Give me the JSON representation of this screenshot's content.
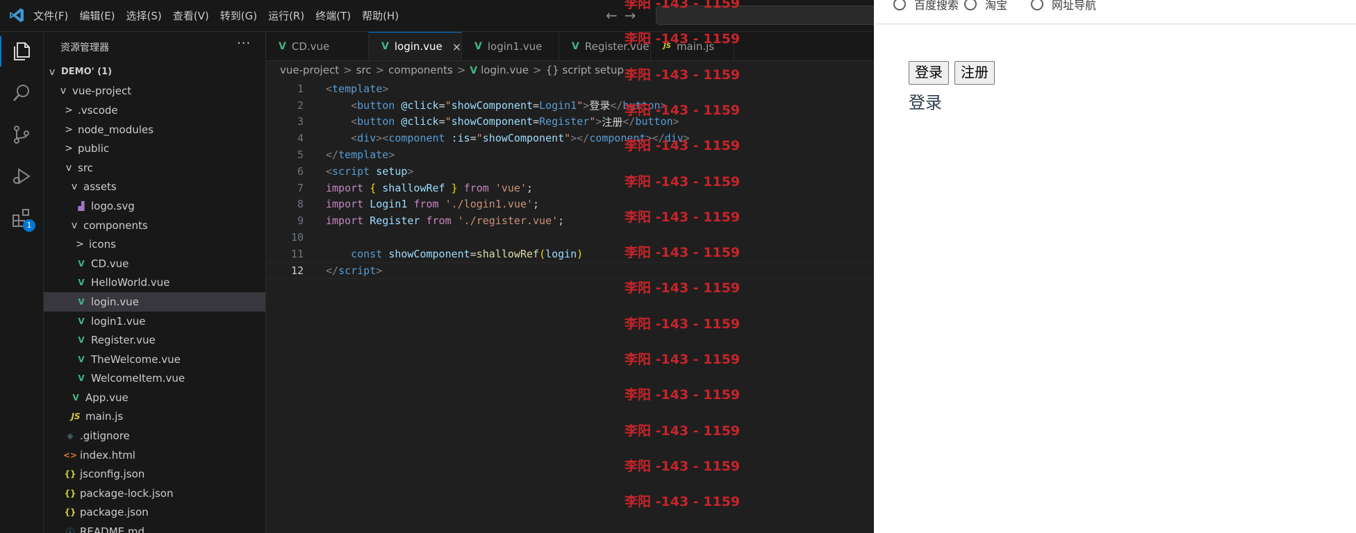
{
  "menu": [
    "文件(F)",
    "编辑(E)",
    "选择(S)",
    "查看(V)",
    "转到(G)",
    "运行(R)",
    "终端(T)",
    "帮助(H)"
  ],
  "nav": {
    "back": "←",
    "forward": "→"
  },
  "activity": {
    "extensions_badge": "1"
  },
  "sidebar": {
    "title": "资源管理器",
    "more": "···",
    "tree": [
      {
        "label": "DEMO' (1)",
        "depth": 0,
        "chevron": "open",
        "icon": "",
        "bold": true
      },
      {
        "label": "vue-project",
        "depth": 1,
        "chevron": "open",
        "icon": ""
      },
      {
        "label": ".vscode",
        "depth": 2,
        "chevron": "closed",
        "icon": ""
      },
      {
        "label": "node_modules",
        "depth": 2,
        "chevron": "closed",
        "icon": ""
      },
      {
        "label": "public",
        "depth": 2,
        "chevron": "closed",
        "icon": ""
      },
      {
        "label": "src",
        "depth": 2,
        "chevron": "open",
        "icon": ""
      },
      {
        "label": "assets",
        "depth": 3,
        "chevron": "open",
        "icon": ""
      },
      {
        "label": "logo.svg",
        "depth": 4,
        "chevron": "",
        "icon": "svg"
      },
      {
        "label": "components",
        "depth": 3,
        "chevron": "open",
        "icon": ""
      },
      {
        "label": "icons",
        "depth": 4,
        "chevron": "closed",
        "icon": ""
      },
      {
        "label": "CD.vue",
        "depth": 4,
        "chevron": "",
        "icon": "vue"
      },
      {
        "label": "HelloWorld.vue",
        "depth": 4,
        "chevron": "",
        "icon": "vue"
      },
      {
        "label": "login.vue",
        "depth": 4,
        "chevron": "",
        "icon": "vue",
        "selected": true
      },
      {
        "label": "login1.vue",
        "depth": 4,
        "chevron": "",
        "icon": "vue"
      },
      {
        "label": "Register.vue",
        "depth": 4,
        "chevron": "",
        "icon": "vue"
      },
      {
        "label": "TheWelcome.vue",
        "depth": 4,
        "chevron": "",
        "icon": "vue"
      },
      {
        "label": "WelcomeItem.vue",
        "depth": 4,
        "chevron": "",
        "icon": "vue"
      },
      {
        "label": "App.vue",
        "depth": 3,
        "chevron": "",
        "icon": "vue"
      },
      {
        "label": "main.js",
        "depth": 3,
        "chevron": "",
        "icon": "js"
      },
      {
        "label": ".gitignore",
        "depth": 2,
        "chevron": "",
        "icon": "git"
      },
      {
        "label": "index.html",
        "depth": 2,
        "chevron": "",
        "icon": "html"
      },
      {
        "label": "jsconfig.json",
        "depth": 2,
        "chevron": "",
        "icon": "json"
      },
      {
        "label": "package-lock.json",
        "depth": 2,
        "chevron": "",
        "icon": "json"
      },
      {
        "label": "package.json",
        "depth": 2,
        "chevron": "",
        "icon": "json"
      },
      {
        "label": "README.md",
        "depth": 2,
        "chevron": "",
        "icon": "info"
      }
    ]
  },
  "icons": {
    "vue": "V",
    "js": "JS",
    "json": "{}",
    "html": "<>",
    "git": "◆",
    "svg": "▟",
    "info": "ⓘ",
    "chevron_open": "v",
    "chevron_closed": ">"
  },
  "tabs": [
    {
      "label": "CD.vue",
      "icon": "vue",
      "active": false
    },
    {
      "label": "login.vue",
      "icon": "vue",
      "active": true
    },
    {
      "label": "login1.vue",
      "icon": "vue",
      "active": false
    },
    {
      "label": "Register.vue",
      "icon": "vue",
      "active": false
    },
    {
      "label": "main.js",
      "icon": "js",
      "active": false
    }
  ],
  "breadcrumb": [
    "vue-project",
    "src",
    "components",
    "login.vue",
    "{} script setup"
  ],
  "code": {
    "current_line": 12,
    "lines": [
      [
        [
          "br",
          "<"
        ],
        [
          "tg",
          "template"
        ],
        [
          "br",
          ">"
        ]
      ],
      [
        [
          "ct",
          "    "
        ],
        [
          "br",
          "<"
        ],
        [
          "tg",
          "button"
        ],
        [
          "ct",
          " "
        ],
        [
          "at",
          "@click"
        ],
        [
          "ct",
          "="
        ],
        [
          "st",
          "\""
        ],
        [
          "vr",
          "showComponent"
        ],
        [
          "ct",
          "="
        ],
        [
          "ks",
          "Login1"
        ],
        [
          "st",
          "\""
        ],
        [
          "br",
          ">"
        ],
        [
          "ct",
          "登录"
        ],
        [
          "br",
          "</"
        ],
        [
          "tg",
          "button"
        ],
        [
          "br",
          ">"
        ]
      ],
      [
        [
          "ct",
          "    "
        ],
        [
          "br",
          "<"
        ],
        [
          "tg",
          "button"
        ],
        [
          "ct",
          " "
        ],
        [
          "at",
          "@click"
        ],
        [
          "ct",
          "="
        ],
        [
          "st",
          "\""
        ],
        [
          "vr",
          "showComponent"
        ],
        [
          "ct",
          "="
        ],
        [
          "ks",
          "Register"
        ],
        [
          "st",
          "\""
        ],
        [
          "br",
          ">"
        ],
        [
          "ct",
          "注册"
        ],
        [
          "br",
          "</"
        ],
        [
          "tg",
          "button"
        ],
        [
          "br",
          ">"
        ]
      ],
      [
        [
          "ct",
          "    "
        ],
        [
          "br",
          "<"
        ],
        [
          "tg",
          "div"
        ],
        [
          "br",
          "><"
        ],
        [
          "tg",
          "component"
        ],
        [
          "ct",
          " "
        ],
        [
          "at",
          ":is"
        ],
        [
          "ct",
          "="
        ],
        [
          "st",
          "\""
        ],
        [
          "vr",
          "showComponent"
        ],
        [
          "st",
          "\""
        ],
        [
          "br",
          "></"
        ],
        [
          "tg",
          "component"
        ],
        [
          "br",
          "></"
        ],
        [
          "tg",
          "div"
        ],
        [
          "br",
          ">"
        ]
      ],
      [
        [
          "br",
          "</"
        ],
        [
          "tg",
          "template"
        ],
        [
          "br",
          ">"
        ]
      ],
      [
        [
          "br",
          "<"
        ],
        [
          "tg",
          "script"
        ],
        [
          "ct",
          " "
        ],
        [
          "at",
          "setup"
        ],
        [
          "br",
          ">"
        ]
      ],
      [
        [
          "kw",
          "import"
        ],
        [
          "ct",
          " "
        ],
        [
          "yb",
          "{"
        ],
        [
          "ct",
          " "
        ],
        [
          "vr",
          "shallowRef"
        ],
        [
          "ct",
          " "
        ],
        [
          "yb",
          "}"
        ],
        [
          "ct",
          " "
        ],
        [
          "kw",
          "from"
        ],
        [
          "ct",
          " "
        ],
        [
          "st",
          "'vue'"
        ],
        [
          "ct",
          ";"
        ]
      ],
      [
        [
          "kw",
          "import"
        ],
        [
          "ct",
          " "
        ],
        [
          "vr",
          "Login1"
        ],
        [
          "ct",
          " "
        ],
        [
          "kw",
          "from"
        ],
        [
          "ct",
          " "
        ],
        [
          "st",
          "'./login1.vue'"
        ],
        [
          "ct",
          ";"
        ]
      ],
      [
        [
          "kw",
          "import"
        ],
        [
          "ct",
          " "
        ],
        [
          "vr",
          "Register"
        ],
        [
          "ct",
          " "
        ],
        [
          "kw",
          "from"
        ],
        [
          "ct",
          " "
        ],
        [
          "st",
          "'./register.vue'"
        ],
        [
          "ct",
          ";"
        ]
      ],
      [
        [
          "ct",
          ""
        ]
      ],
      [
        [
          "ct",
          "    "
        ],
        [
          "ks",
          "const"
        ],
        [
          "ct",
          " "
        ],
        [
          "vr",
          "showComponent"
        ],
        [
          "ct",
          "="
        ],
        [
          "fn",
          "shallowRef"
        ],
        [
          "yb",
          "("
        ],
        [
          "vr",
          "login"
        ],
        [
          "yb",
          ")"
        ]
      ],
      [
        [
          "br",
          "</"
        ],
        [
          "tg",
          "script"
        ],
        [
          "br",
          ">"
        ]
      ]
    ]
  },
  "watermark": "李阳 -143 - 1159",
  "browser": {
    "bookmarks": [
      "百度搜索",
      "淘宝",
      "网址导航"
    ],
    "buttons": [
      "登录",
      "注册"
    ],
    "output_text": "登录"
  }
}
